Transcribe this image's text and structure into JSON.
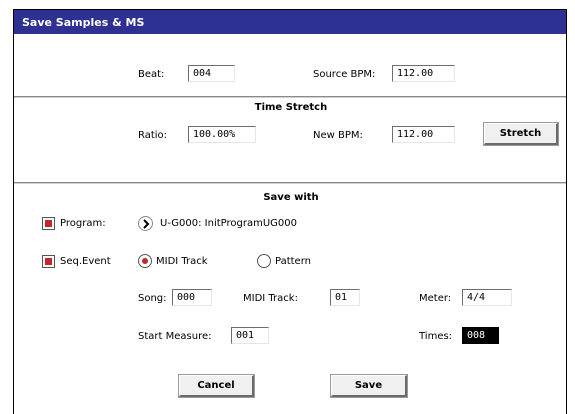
{
  "dialog": {
    "title": "Save Samples & MS"
  },
  "top": {
    "beat_label": "Beat:",
    "beat_value": "004",
    "source_bpm_label": "Source BPM:",
    "source_bpm_value": "112.00"
  },
  "time_stretch": {
    "title": "Time Stretch",
    "ratio_label": "Ratio:",
    "ratio_value": "100.00%",
    "new_bpm_label": "New BPM:",
    "new_bpm_value": "112.00",
    "stretch_button": "Stretch"
  },
  "save_with": {
    "title": "Save with",
    "program_label": "Program:",
    "program_checked": true,
    "program_value": "U-G000: InitProgramUG000",
    "seq_event_label": "Seq.Event",
    "seq_event_checked": true,
    "midi_track_option": "MIDI Track",
    "pattern_option": "Pattern",
    "selected_option": "MIDI Track",
    "song_label": "Song:",
    "song_value": "000",
    "midi_track_label": "MIDI Track:",
    "midi_track_value": "01",
    "meter_label": "Meter:",
    "meter_value": "4/4",
    "start_measure_label": "Start Measure:",
    "start_measure_value": "001",
    "times_label": "Times:",
    "times_value": "008"
  },
  "buttons": {
    "cancel": "Cancel",
    "save": "Save"
  },
  "colors": {
    "titlebar": "#2e3192",
    "checkbox_mark": "#c1272d",
    "selected_field": "#000000"
  },
  "icons": {
    "program_select": "chevron-right-icon"
  }
}
